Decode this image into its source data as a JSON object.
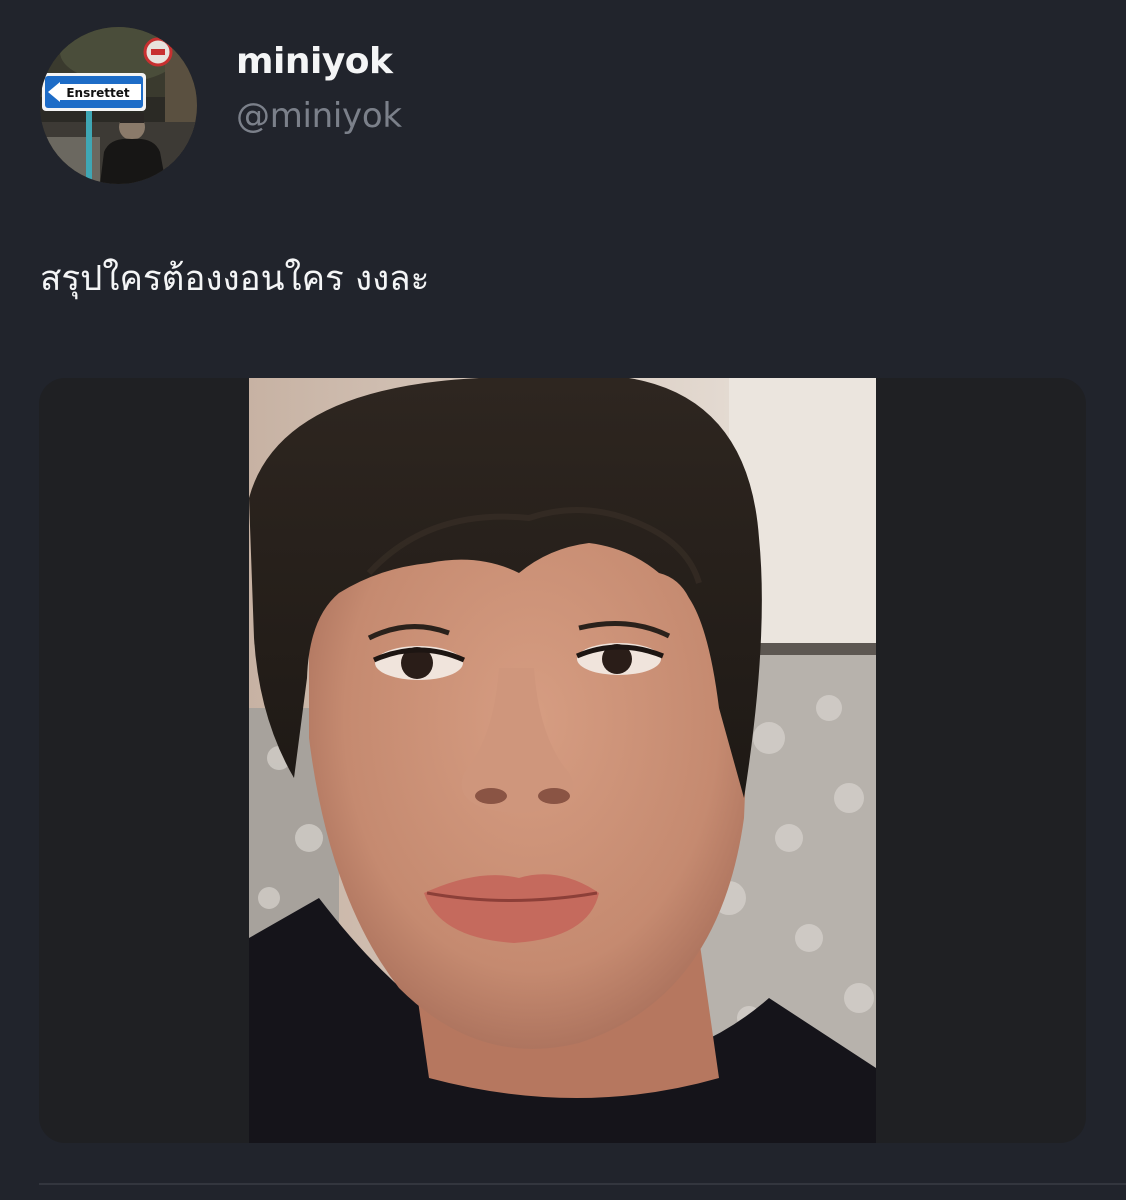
{
  "tweet": {
    "display_name": "miniyok",
    "handle": "@miniyok",
    "text": "สรุปใครต้องงอนใคร งงละ",
    "avatar": {
      "icon": "profile-photo-street-sign",
      "sign_text": "Ensrettet"
    },
    "media": {
      "description_icon": "selfie-photo"
    }
  },
  "colors": {
    "background": "#21242c",
    "primary_text": "#f4f5f6",
    "secondary_text": "#7b808a",
    "media_letterbox": "#1f2023"
  }
}
